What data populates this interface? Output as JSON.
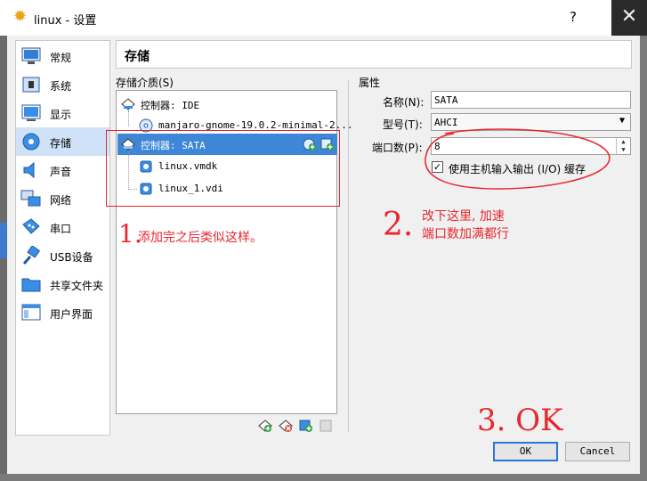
{
  "window": {
    "title": "linux - 设置",
    "help_label": "?",
    "close_label": "✕"
  },
  "sidebar": {
    "items": [
      {
        "label": "常规",
        "icon": "general-icon"
      },
      {
        "label": "系统",
        "icon": "system-icon"
      },
      {
        "label": "显示",
        "icon": "display-icon"
      },
      {
        "label": "存储",
        "icon": "storage-icon",
        "selected": true
      },
      {
        "label": "声音",
        "icon": "audio-icon"
      },
      {
        "label": "网络",
        "icon": "network-icon"
      },
      {
        "label": "串口",
        "icon": "serial-port-icon"
      },
      {
        "label": "USB设备",
        "icon": "usb-icon"
      },
      {
        "label": "共享文件夹",
        "icon": "shared-folder-icon"
      },
      {
        "label": "用户界面",
        "icon": "user-interface-icon"
      }
    ]
  },
  "section_title": "存储",
  "storage_tree": {
    "label": "存储介质(S)",
    "controllers": [
      {
        "label": "控制器: IDE",
        "devices": [
          "manjaro-gnome-19.0.2-minimal-2..."
        ]
      },
      {
        "label": "控制器: SATA",
        "selected": true,
        "devices": [
          "linux.vmdk",
          "linux_1.vdi"
        ]
      }
    ]
  },
  "properties": {
    "label": "属性",
    "name_label": "名称(N):",
    "name_value": "SATA",
    "type_label": "型号(T):",
    "type_value": "AHCI",
    "ports_label": "端口数(P):",
    "ports_value": "8",
    "host_io_cache_label": "使用主机输入输出 (I/O) 缓存",
    "host_io_cache_checked": true
  },
  "buttons": {
    "ok": "OK",
    "cancel": "Cancel"
  },
  "annotations": {
    "note1_number": "1.",
    "note1_text": "添加完之后类似这样。",
    "note2_number": "2.",
    "note2_line1": "改下这里, 加速",
    "note2_line2": "端口数加满都行",
    "note3": "3. OK"
  },
  "colors": {
    "selection": "#3d87d6",
    "annotation": "#e8262e",
    "sidebar_selected": "#cfe2f7"
  }
}
